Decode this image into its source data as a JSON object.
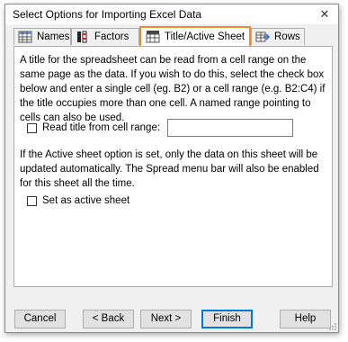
{
  "window": {
    "title": "Select Options for Importing Excel Data",
    "close_glyph": "✕"
  },
  "tabs": [
    {
      "label": "Names",
      "icon": "table-grid-icon"
    },
    {
      "label": "Factors",
      "icon": "factor-columns-icon"
    },
    {
      "label": "Title/Active Sheet",
      "icon": "title-sheet-icon"
    },
    {
      "label": "Rows",
      "icon": "rows-arrow-icon"
    }
  ],
  "active_tab": "Title/Active Sheet",
  "accent_color": "#f08a2a",
  "panel": {
    "intro_text": "A title for the spreadsheet can be read from a cell range on the same page as the data. If you wish to do this, select the check box below and enter a single cell (eg. B2) or a cell range (e.g. B2:C4) if the title occupies more than one cell. A named range pointing to cells can also be used.",
    "read_title_label": "Read title from cell range:",
    "read_title_checked": false,
    "range_value": "",
    "active_sheet_text": "If the Active sheet option is set, only the data on this sheet will be updated automatically. The Spread menu bar will also be enabled for this sheet all the time.",
    "set_active_label": "Set as active sheet",
    "set_active_checked": false
  },
  "buttons": {
    "cancel": "Cancel",
    "back": "< Back",
    "next": "Next >",
    "finish": "Finish",
    "help": "Help"
  }
}
